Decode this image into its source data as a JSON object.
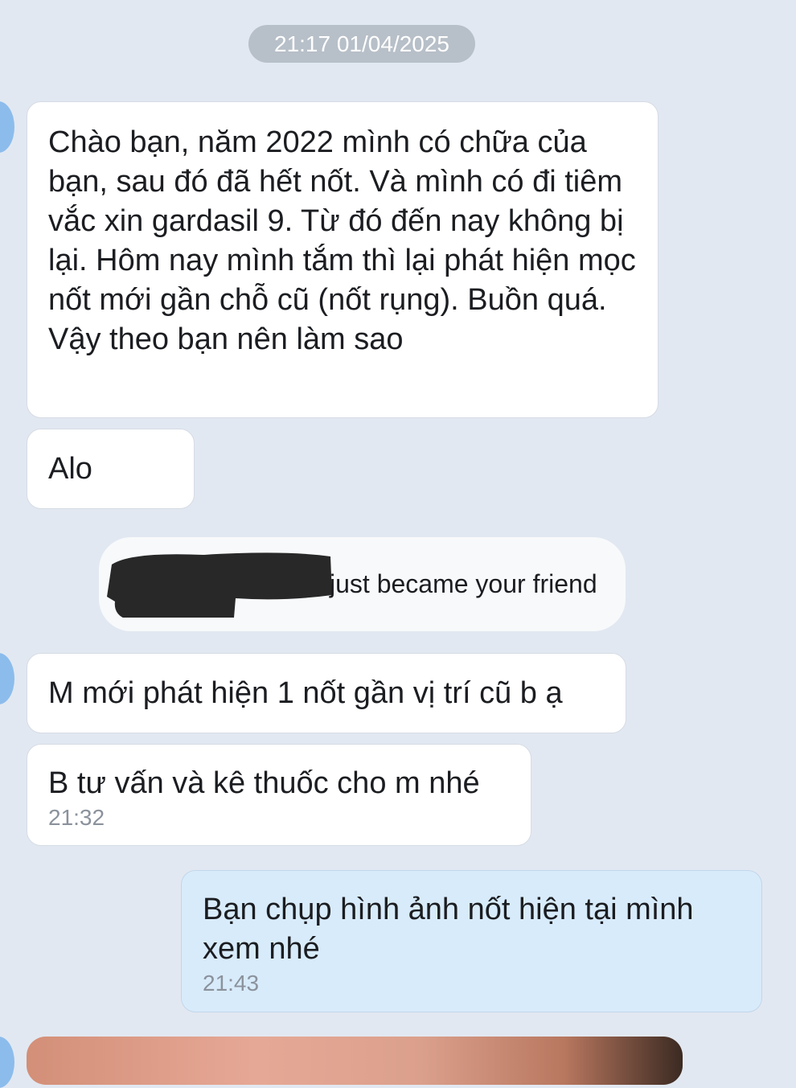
{
  "chat": {
    "date_separator": "21:17 01/04/2025",
    "system_notice": "just became your friend",
    "messages": [
      {
        "side": "incoming",
        "text": "Chào bạn, năm 2022 mình có chữa của bạn, sau đó đã hết nốt. Và mình có đi tiêm vắc xin gardasil 9. Từ đó đến nay không bị lại. Hôm nay mình tắm thì lại phát hiện mọc nốt mới gần chỗ cũ (nốt rụng). Buồn quá. Vậy theo bạn nên làm sao"
      },
      {
        "side": "incoming",
        "text": "Alo"
      },
      {
        "side": "incoming",
        "text": "M mới phát hiện 1 nốt gần vị trí cũ b ạ"
      },
      {
        "side": "incoming",
        "text": "B tư vấn và kê thuốc cho m nhé",
        "time": "21:32"
      },
      {
        "side": "outgoing",
        "text": "Bạn chụp hình ảnh nốt hiện tại mình xem nhé",
        "time": "21:43"
      }
    ]
  },
  "colors": {
    "background": "#e2e8f1",
    "incoming_bubble": "#ffffff",
    "outgoing_bubble": "#d8ebfb",
    "avatar": "#8cbcec",
    "date_pill": "#b7bfc8"
  }
}
